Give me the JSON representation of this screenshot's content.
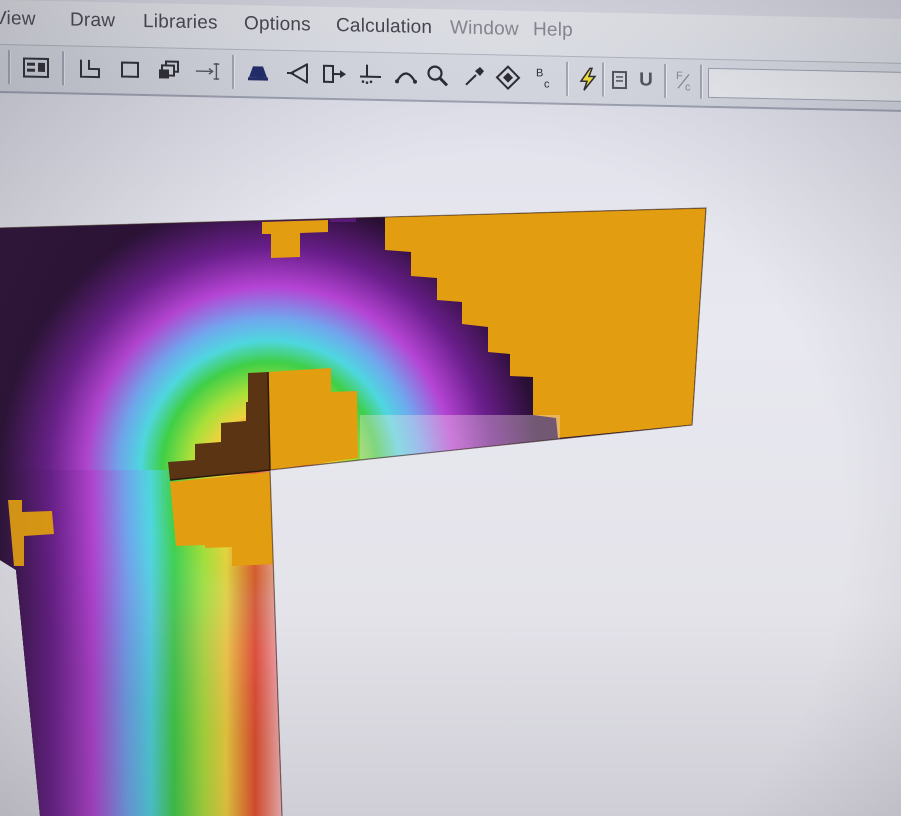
{
  "menu": {
    "items": [
      {
        "label": "View",
        "enabled": true
      },
      {
        "label": "Draw",
        "enabled": true
      },
      {
        "label": "Libraries",
        "enabled": true
      },
      {
        "label": "Options",
        "enabled": true
      },
      {
        "label": "Calculation",
        "enabled": true
      },
      {
        "label": "Window",
        "enabled": false
      },
      {
        "label": "Help",
        "enabled": false
      }
    ]
  },
  "toolbar": {
    "buttons": [
      {
        "icon": "material-list-icon"
      },
      {
        "icon": "polyline-icon"
      },
      {
        "icon": "rectangle-icon"
      },
      {
        "icon": "copy-layers-icon"
      },
      {
        "icon": "dimension-icon"
      },
      {
        "icon": "fill-bucket-icon"
      },
      {
        "icon": "move-node-icon"
      },
      {
        "icon": "insert-node-icon"
      },
      {
        "icon": "snap-point-icon"
      },
      {
        "icon": "arc-icon"
      },
      {
        "icon": "zoom-icon"
      },
      {
        "icon": "eyedropper-icon"
      },
      {
        "icon": "eraser-icon"
      },
      {
        "icon": "boundary-condition-icon",
        "glyph_top": "B",
        "glyph_bottom": "c"
      },
      {
        "icon": "calculate-lightning-icon"
      },
      {
        "icon": "results-icon"
      },
      {
        "icon": "u-factor-icon",
        "glyph": "U"
      },
      {
        "icon": "fraction-icon",
        "glyph_top": "F",
        "glyph_bottom": "c"
      }
    ]
  },
  "colors": {
    "accent_orange": "#e39d10",
    "dark_brown": "#5b3414",
    "menu_text": "#46464f",
    "disabled_text": "#8a8b95"
  }
}
